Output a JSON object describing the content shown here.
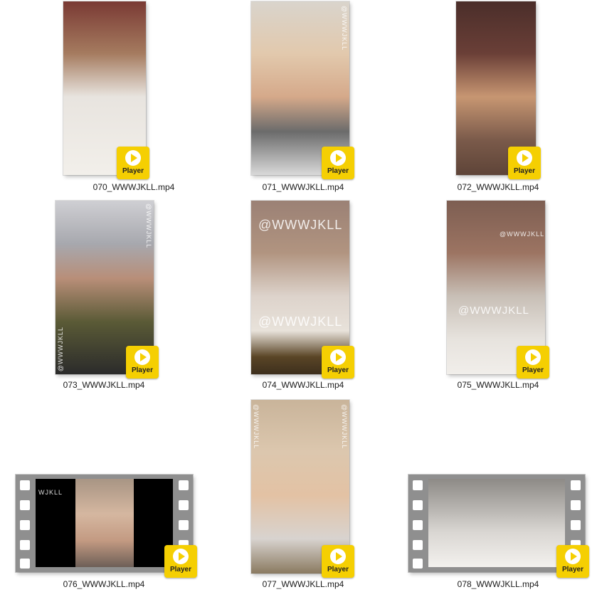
{
  "files": [
    {
      "name": "070_WWWJKLL.mp4"
    },
    {
      "name": "071_WWWJKLL.mp4"
    },
    {
      "name": "072_WWWJKLL.mp4"
    },
    {
      "name": "073_WWWJKLL.mp4"
    },
    {
      "name": "074_WWWJKLL.mp4"
    },
    {
      "name": "075_WWWJKLL.mp4"
    },
    {
      "name": "076_WWWJKLL.mp4"
    },
    {
      "name": "077_WWWJKLL.mp4"
    },
    {
      "name": "078_WWWJKLL.mp4"
    }
  ],
  "badge": {
    "label": "Player",
    "color": "#f5cf02",
    "icon": "play-icon"
  },
  "watermarks": {
    "handle": "@WWWJKLL",
    "partial": "WJKLL"
  }
}
